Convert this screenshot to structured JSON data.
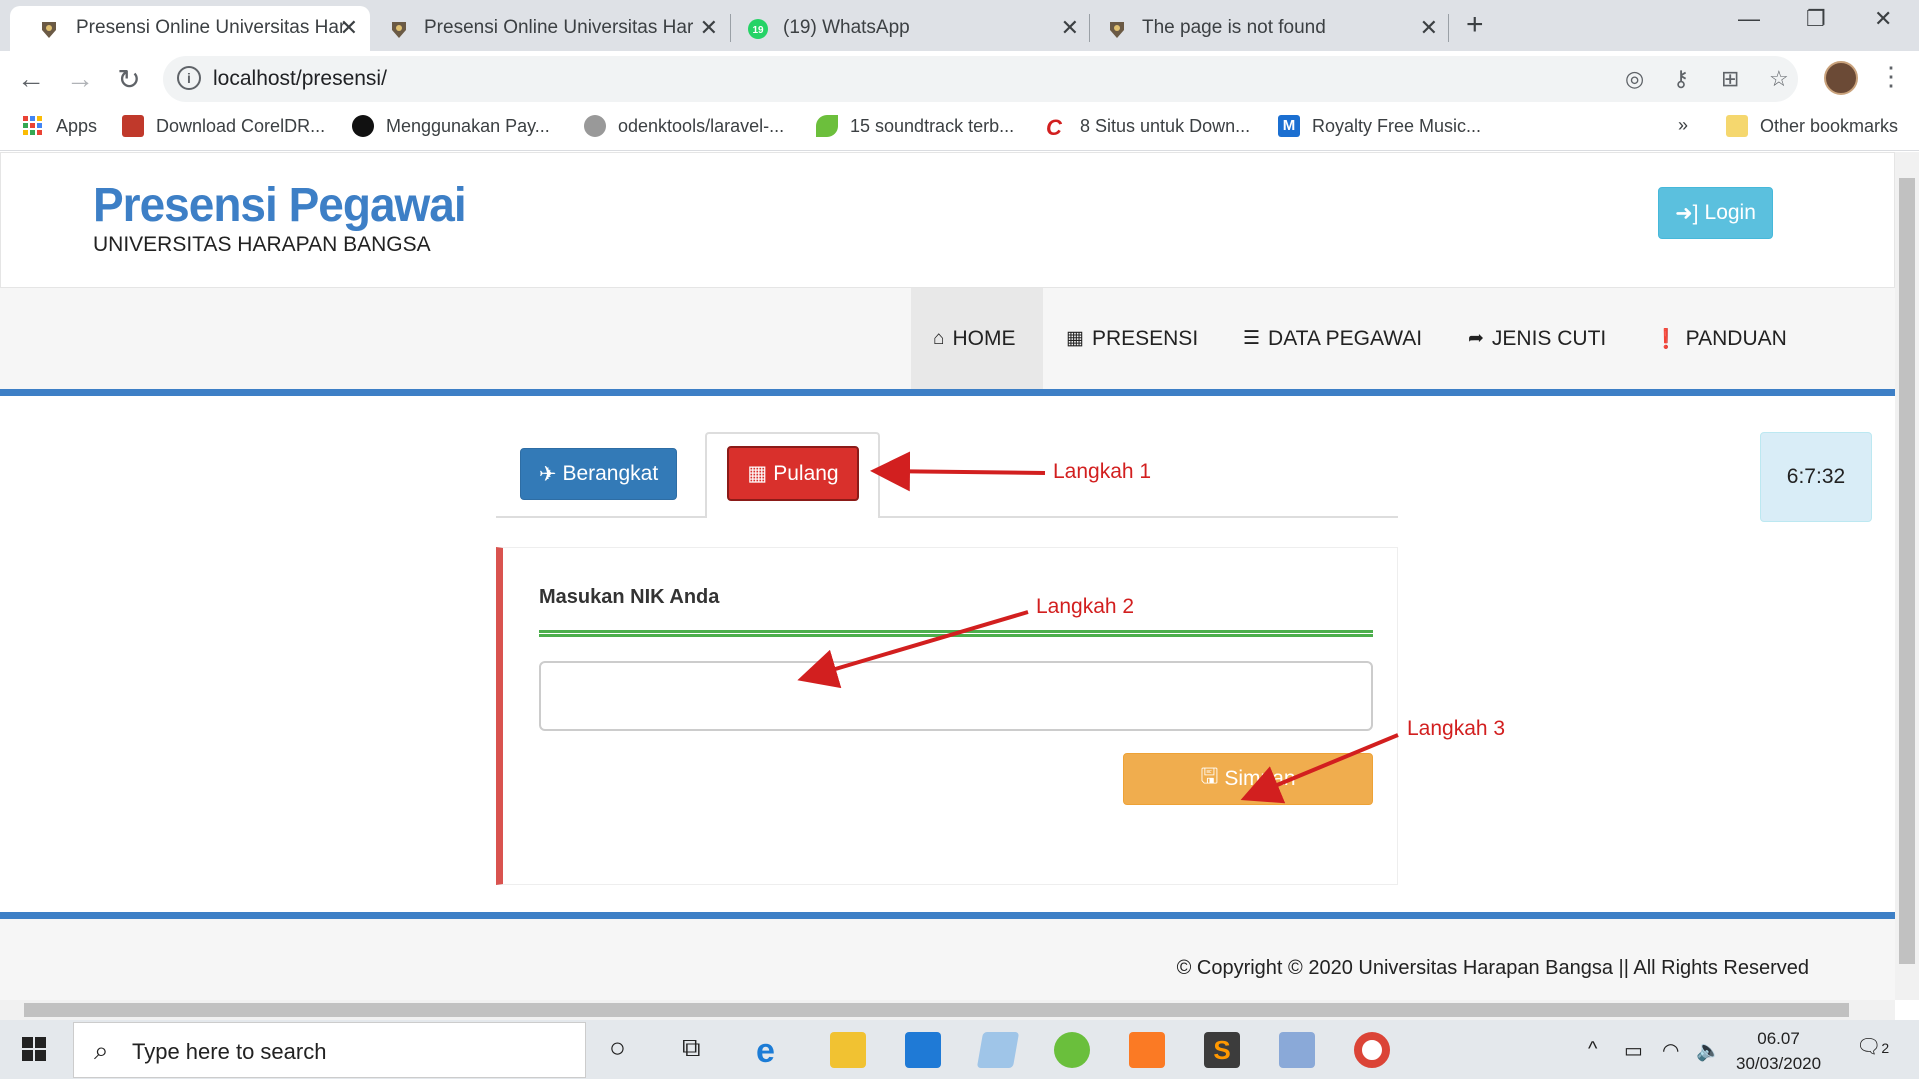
{
  "browser": {
    "tabs": [
      {
        "title": "Presensi Online Universitas Harap",
        "active": true
      },
      {
        "title": "Presensi Online Universitas Harap",
        "active": false
      },
      {
        "title": "(19) WhatsApp",
        "active": false,
        "badge": "19"
      },
      {
        "title": "The page is not found",
        "active": false
      }
    ],
    "url": "localhost/presensi/",
    "bookmarks": [
      "Apps",
      "Download CorelDR...",
      "Menggunakan Pay...",
      "odenktools/laravel-...",
      "15 soundtrack terb...",
      "8 Situs untuk Down...",
      "Royalty Free Music...",
      "Other bookmarks"
    ],
    "more_bookmarks": "»"
  },
  "page": {
    "brand_title": "Presensi Pegawai",
    "brand_subtitle": "UNIVERSITAS HARAPAN BANGSA",
    "login_label": "Login",
    "nav": [
      {
        "label": "HOME",
        "icon": "home-icon",
        "active": true
      },
      {
        "label": "PRESENSI",
        "icon": "calendar-icon",
        "active": false
      },
      {
        "label": "DATA PEGAWAI",
        "icon": "list-icon",
        "active": false
      },
      {
        "label": "JENIS CUTI",
        "icon": "share-icon",
        "active": false
      },
      {
        "label": "PANDUAN",
        "icon": "info-icon",
        "active": false
      }
    ],
    "berangkat_label": "Berangkat",
    "pulang_label": "Pulang",
    "clock": "6:7:32",
    "form_label": "Masukan NIK Anda",
    "nik_value": "",
    "simpan_label": "Simpan",
    "annotations": {
      "step1": "Langkah 1",
      "step2": "Langkah 2",
      "step3": "Langkah 3"
    },
    "footer": "© Copyright © 2020 Universitas Harapan Bangsa || All Rights Reserved"
  },
  "taskbar": {
    "search_placeholder": "Type here to search",
    "time": "06.07",
    "date": "30/03/2020",
    "notification_count": "2"
  },
  "colors": {
    "brand": "#3d7fc6",
    "login": "#5bc0de",
    "berangkat": "#337ab7",
    "pulang": "#d9302c",
    "simpan": "#f0ad4e",
    "annotation": "#d21f1f"
  }
}
